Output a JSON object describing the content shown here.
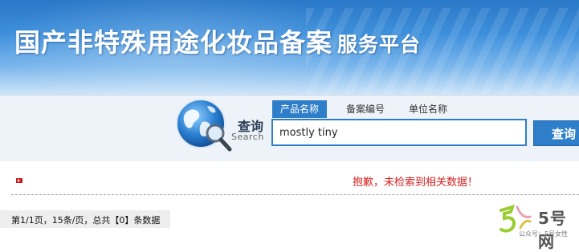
{
  "banner": {
    "title": "国产非特殊用途化妆品备案",
    "subtitle": "服务平台"
  },
  "search": {
    "label_cn": "查询",
    "label_en": "Search",
    "tabs": [
      {
        "label": "产品名称",
        "active": true
      },
      {
        "label": "备案编号",
        "active": false
      },
      {
        "label": "单位名称",
        "active": false
      }
    ],
    "query": "mostly tiny",
    "button_label": "查询"
  },
  "results": {
    "message": "抱歉，未检索到相关数据！",
    "pager": "第1/1页，15条/页，总共【0】条数据"
  },
  "watermark": {
    "brand": "5号网",
    "sub": "公众号：5号女性"
  },
  "colors": {
    "accent": "#2f7ec9",
    "error": "#d42020"
  }
}
